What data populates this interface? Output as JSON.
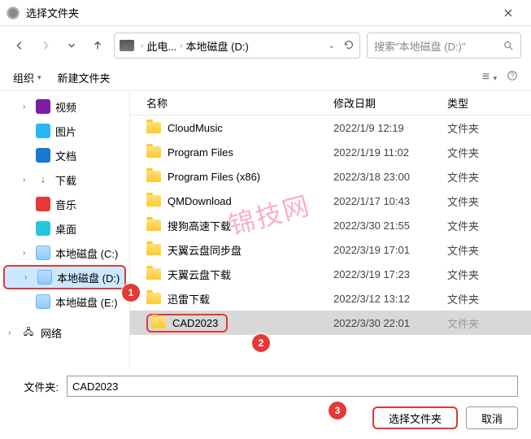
{
  "window": {
    "title": "选择文件夹"
  },
  "breadcrumb": {
    "pc": "此电...",
    "drive": "本地磁盘 (D:)"
  },
  "search": {
    "placeholder": "搜索\"本地磁盘 (D:)\""
  },
  "toolbar": {
    "organize": "组织",
    "newfolder": "新建文件夹"
  },
  "columns": {
    "name": "名称",
    "date": "修改日期",
    "type": "类型"
  },
  "tree": [
    {
      "label": "视频",
      "icon": "i-video",
      "chev": "›"
    },
    {
      "label": "图片",
      "icon": "i-picture",
      "chev": ""
    },
    {
      "label": "文档",
      "icon": "i-doc",
      "chev": ""
    },
    {
      "label": "下载",
      "icon": "i-download",
      "chev": "›",
      "glyph": "↓"
    },
    {
      "label": "音乐",
      "icon": "i-music",
      "chev": ""
    },
    {
      "label": "桌面",
      "icon": "i-desktop",
      "chev": ""
    },
    {
      "label": "本地磁盘 (C:)",
      "icon": "i-drive",
      "chev": "›"
    },
    {
      "label": "本地磁盘 (D:)",
      "icon": "i-drive",
      "chev": "›",
      "selected": true
    },
    {
      "label": "本地磁盘 (E:)",
      "icon": "i-drive",
      "chev": ""
    },
    {
      "label": "网络",
      "icon": "i-network",
      "chev": "›",
      "top": true,
      "glyph": "🖧"
    }
  ],
  "files": [
    {
      "name": "CloudMusic",
      "date": "2022/1/9 12:19",
      "type": "文件夹"
    },
    {
      "name": "Program Files",
      "date": "2022/1/19 11:02",
      "type": "文件夹"
    },
    {
      "name": "Program Files (x86)",
      "date": "2022/3/18 23:00",
      "type": "文件夹"
    },
    {
      "name": "QMDownload",
      "date": "2022/1/17 10:43",
      "type": "文件夹"
    },
    {
      "name": "搜狗高速下载",
      "date": "2022/3/30 21:55",
      "type": "文件夹"
    },
    {
      "name": "天翼云盘同步盘",
      "date": "2022/3/19 17:01",
      "type": "文件夹"
    },
    {
      "name": "天翼云盘下载",
      "date": "2022/3/19 17:23",
      "type": "文件夹"
    },
    {
      "name": "迅雷下载",
      "date": "2022/3/12 13:12",
      "type": "文件夹"
    },
    {
      "name": "CAD2023",
      "date": "2022/3/30 22:01",
      "type": "文件夹",
      "selected": true
    }
  ],
  "footer": {
    "label": "文件夹:",
    "value": "CAD2023",
    "select": "选择文件夹",
    "cancel": "取消"
  },
  "watermark": "锦技网",
  "annotations": {
    "a1": "1",
    "a2": "2",
    "a3": "3"
  }
}
